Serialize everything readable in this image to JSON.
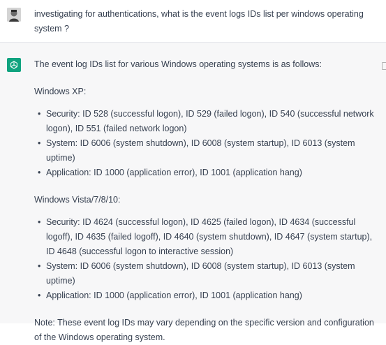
{
  "user_message": {
    "text": "investigating for authentications, what is the event logs IDs list per windows operating system ?"
  },
  "assistant": {
    "intro": "The event log IDs list for various Windows operating systems is as follows:",
    "sections": [
      {
        "heading": "Windows XP:",
        "items": [
          "Security: ID 528 (successful logon), ID 529 (failed logon), ID 540 (successful network logon), ID 551 (failed network logon)",
          "System: ID 6006 (system shutdown), ID 6008 (system startup), ID 6013 (system uptime)",
          "Application: ID 1000 (application error), ID 1001 (application hang)"
        ]
      },
      {
        "heading": "Windows Vista/7/8/10:",
        "items": [
          "Security: ID 4624 (successful logon), ID 4625 (failed logon), ID 4634 (successful logoff), ID 4635 (failed logoff), ID 4640 (system shutdown), ID 4647 (system startup), ID 4648 (successful logon to interactive session)",
          "System: ID 6006 (system shutdown), ID 6008 (system startup), ID 6013 (system uptime)",
          "Application: ID 1000 (application error), ID 1001 (application hang)"
        ]
      }
    ],
    "note": "Note: These event log IDs may vary depending on the specific version and configuration of the Windows operating system."
  },
  "icons": {
    "user_avatar": "user-avatar",
    "assistant_avatar": "openai-logo-icon",
    "copy": "copy-icon"
  },
  "colors": {
    "assistant_bg": "#f7f7f8",
    "assistant_avatar_bg": "#10a37f",
    "text": "#374151"
  }
}
